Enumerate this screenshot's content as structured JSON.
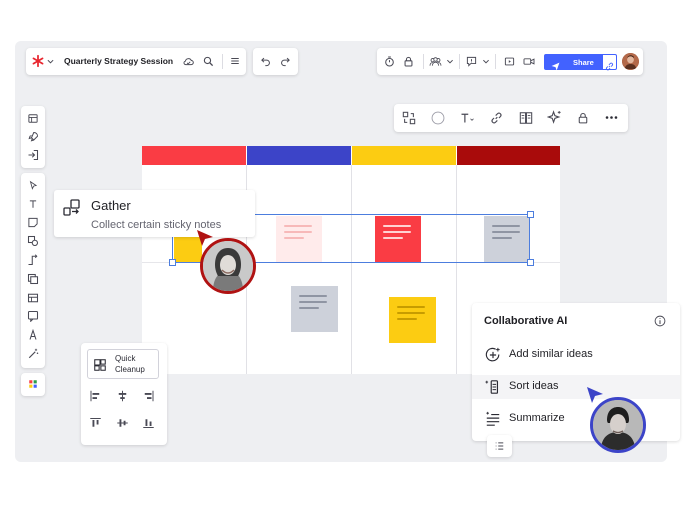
{
  "header": {
    "board_title": "Quarterly Strategy Session",
    "share_label": "Share"
  },
  "tooltip": {
    "title": "Gather",
    "subtitle": "Collect certain sticky notes"
  },
  "quick_cleanup": {
    "label_line1": "Quick",
    "label_line2": "Cleanup"
  },
  "ai_panel": {
    "title": "Collaborative AI",
    "items": [
      {
        "label": "Add similar ideas"
      },
      {
        "label": "Sort ideas"
      },
      {
        "label": "Summarize"
      }
    ]
  },
  "colors": {
    "accent": "#4262ff",
    "column_red": "#fa3c44",
    "column_blue": "#3c44c8",
    "column_yellow": "#fccc12",
    "column_darkred": "#a90b0b",
    "sticky_pink": "#ffebeb",
    "sticky_red": "#fa3c44",
    "sticky_gray": "#cdd1da",
    "sticky_yellow": "#fccc12",
    "cursor_red": "#b01212",
    "cursor_blue": "#3c44c8"
  }
}
